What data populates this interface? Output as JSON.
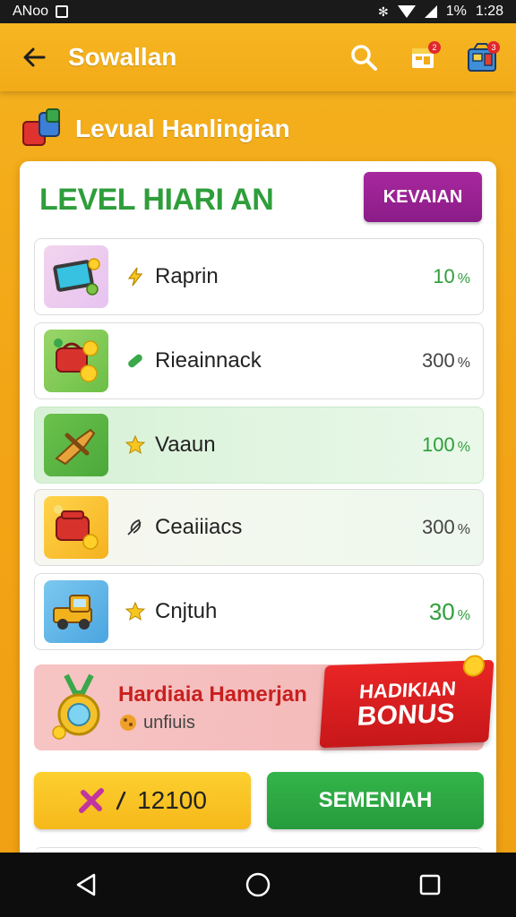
{
  "status_bar": {
    "carrier": "ANoo",
    "battery": "1%",
    "time": "1:28"
  },
  "app_bar": {
    "title": "Sowallan",
    "back_icon": "back-arrow-icon",
    "actions": [
      {
        "name": "search-icon"
      },
      {
        "name": "calendar-icon",
        "badge": "2"
      },
      {
        "name": "shop-icon",
        "badge": "3"
      }
    ]
  },
  "section": {
    "title": "Levual Hanlingian"
  },
  "card": {
    "title": "LEVEL HIARI AN",
    "action_label": "KEVAIAN",
    "rows": [
      {
        "label": "Raprin",
        "value": "10",
        "unit": "%",
        "icon": "lightning-icon",
        "value_color": "green",
        "style": "plain"
      },
      {
        "label": "Rieainnack",
        "value": "300",
        "unit": "%",
        "icon": "pill-icon",
        "value_color": "gray",
        "style": "plain"
      },
      {
        "label": "Vaaun",
        "value": "100",
        "unit": "%",
        "icon": "star-icon",
        "value_color": "green",
        "style": "green"
      },
      {
        "label": "Ceaiiiacs",
        "value": "300",
        "unit": "%",
        "icon": "feather-icon",
        "value_color": "gray",
        "style": "soft"
      },
      {
        "label": "Cnjtuh",
        "value": "30",
        "unit": "%",
        "icon": "star-icon",
        "value_color": "green",
        "style": "plain"
      }
    ],
    "bonus": {
      "title": "Hardiaia Hamerjan",
      "subtitle": "unfiuis",
      "badge_line1": "HADIKIAN",
      "badge_line2": "BONUS"
    },
    "score_value": "12100",
    "primary_label": "SEMENIAH"
  },
  "colors": {
    "brand_orange": "#f3ab18",
    "green": "#2e9e3a",
    "purple": "#8a1c87",
    "red": "#c8201f"
  }
}
